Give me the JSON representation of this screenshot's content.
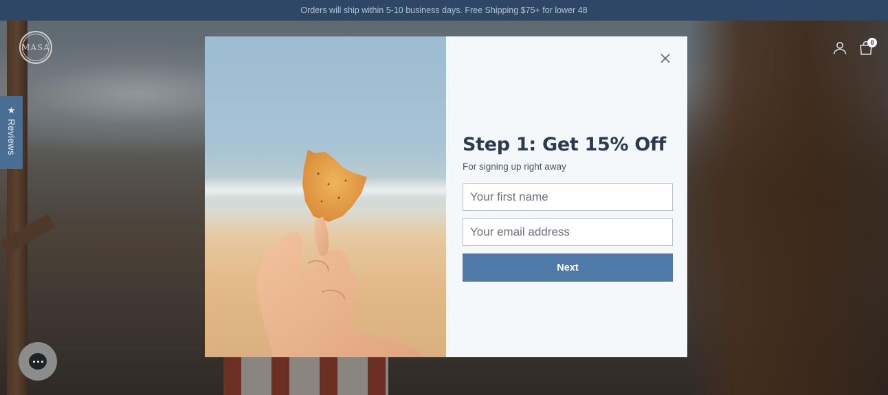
{
  "announcement": {
    "text": "Orders will ship within 5-10 business days. Free Shipping $75+ for lower 48"
  },
  "header": {
    "logo_text": "MASA",
    "cart_count": "0",
    "icons": [
      "account-icon",
      "cart-icon"
    ]
  },
  "reviews_tab": {
    "label": "Reviews",
    "icon": "star-icon"
  },
  "chat_widget": {
    "icon": "chat-icon"
  },
  "popup": {
    "title": "Step 1: Get 15% Off",
    "subtitle": "For signing up right away",
    "first_name_placeholder": "Your first name",
    "email_placeholder": "Your email address",
    "first_name_value": "",
    "email_value": "",
    "next_label": "Next",
    "close_icon": "close-icon"
  },
  "colors": {
    "announcement_bg": "#2e4766",
    "button_bg": "#4f7aa8",
    "reviews_tab_bg": "#4a6d94",
    "popup_bg": "#f5f8fa",
    "title_color": "#2c3a4f"
  }
}
